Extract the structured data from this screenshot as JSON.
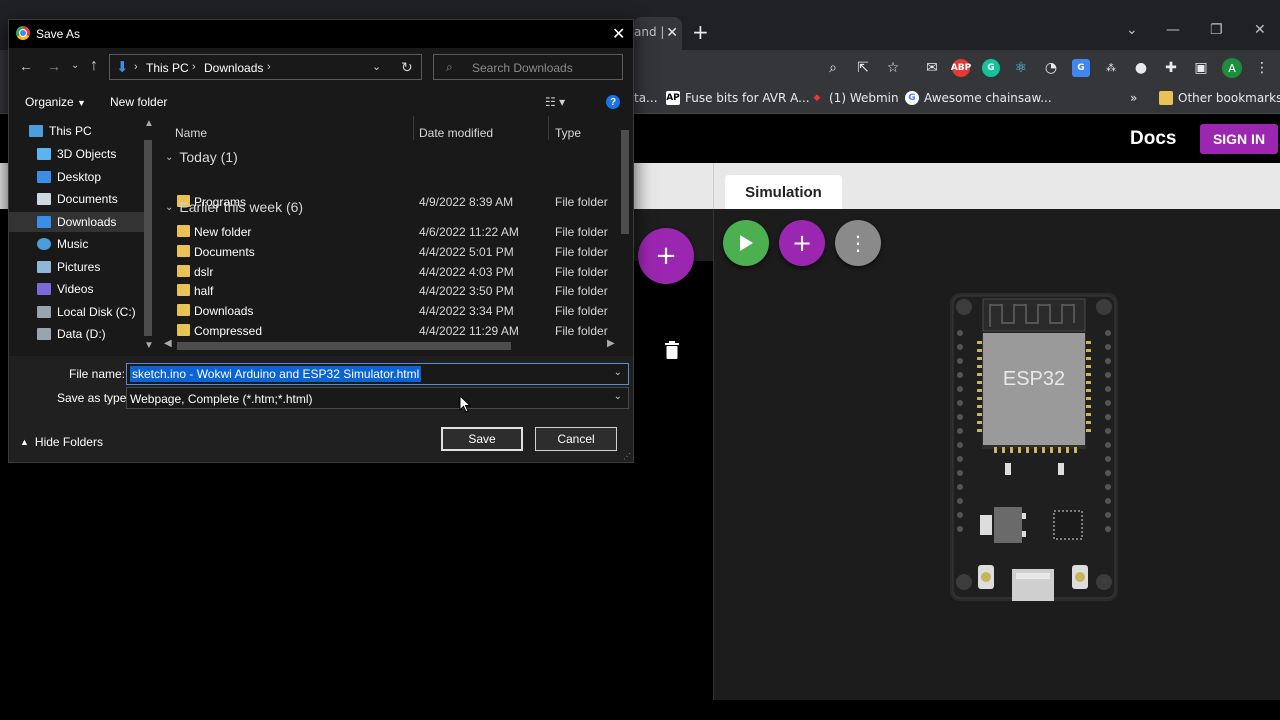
{
  "browser": {
    "partial_tab_text": "and |",
    "new_tab_icon": "plus-icon",
    "window_controls": [
      "chevron-down-icon",
      "minimize-icon",
      "restore-icon",
      "close-icon"
    ],
    "avatar_letter": "A",
    "extensions": [
      "zoom-icon",
      "share-icon",
      "star-icon",
      "gmail-icon",
      "abp-icon",
      "grammarly-icon",
      "react-icon",
      "speed-icon",
      "translate-icon",
      "zip-icon",
      "circle-icon",
      "puzzle-icon",
      "sidebar-icon"
    ],
    "bookmarks": [
      {
        "label": "ta...",
        "icon": "bookmark-icon"
      },
      {
        "label": "Fuse bits for AVR A...",
        "icon": "ap-icon"
      },
      {
        "label": "(1) Webmin",
        "icon": "webmin-icon"
      },
      {
        "label": "Awesome chainsaw...",
        "icon": "google-icon"
      }
    ],
    "bookmarks_overflow": "»",
    "other_bookmarks": "Other bookmarks"
  },
  "wokwi": {
    "docs_label": "Docs",
    "signin_label": "SIGN IN",
    "simulation_tab": "Simulation",
    "chip_label": "ESP32",
    "accent": "#9b27b0",
    "play_color": "#4caf50"
  },
  "dialog": {
    "title": "Save As",
    "address": {
      "root": "This PC",
      "folder": "Downloads"
    },
    "search_placeholder": "Search Downloads",
    "organize_label": "Organize",
    "new_folder_label": "New folder",
    "nav_items": [
      {
        "label": "This PC",
        "icon": "computer-icon"
      },
      {
        "label": "3D Objects",
        "icon": "cube-icon"
      },
      {
        "label": "Desktop",
        "icon": "desktop-icon"
      },
      {
        "label": "Documents",
        "icon": "documents-icon"
      },
      {
        "label": "Downloads",
        "icon": "download-icon"
      },
      {
        "label": "Music",
        "icon": "music-icon"
      },
      {
        "label": "Pictures",
        "icon": "pictures-icon"
      },
      {
        "label": "Videos",
        "icon": "videos-icon"
      },
      {
        "label": "Local Disk (C:)",
        "icon": "disk-icon"
      },
      {
        "label": "Data (D:)",
        "icon": "disk-icon"
      }
    ],
    "columns": {
      "name": "Name",
      "date": "Date modified",
      "type": "Type"
    },
    "groups": [
      {
        "label": "Today (1)",
        "rows": [
          {
            "name": "Programs",
            "date": "4/9/2022 8:39 AM",
            "type": "File folder"
          }
        ]
      },
      {
        "label": "Earlier this week (6)",
        "rows": [
          {
            "name": "New folder",
            "date": "4/6/2022 11:22 AM",
            "type": "File folder"
          },
          {
            "name": "Documents",
            "date": "4/4/2022 5:01 PM",
            "type": "File folder"
          },
          {
            "name": "dslr",
            "date": "4/4/2022 4:03 PM",
            "type": "File folder"
          },
          {
            "name": "half",
            "date": "4/4/2022 3:50 PM",
            "type": "File folder"
          },
          {
            "name": "Downloads",
            "date": "4/4/2022 3:34 PM",
            "type": "File folder"
          },
          {
            "name": "Compressed",
            "date": "4/4/2022 11:29 AM",
            "type": "File folder"
          }
        ]
      }
    ],
    "file_name_label": "File name:",
    "file_name_value": "sketch.ino - Wokwi Arduino and ESP32 Simulator.html",
    "save_type_label": "Save as type:",
    "save_type_value": "Webpage, Complete (*.htm;*.html)",
    "hide_folders_label": "Hide Folders",
    "save_label": "Save",
    "cancel_label": "Cancel"
  }
}
